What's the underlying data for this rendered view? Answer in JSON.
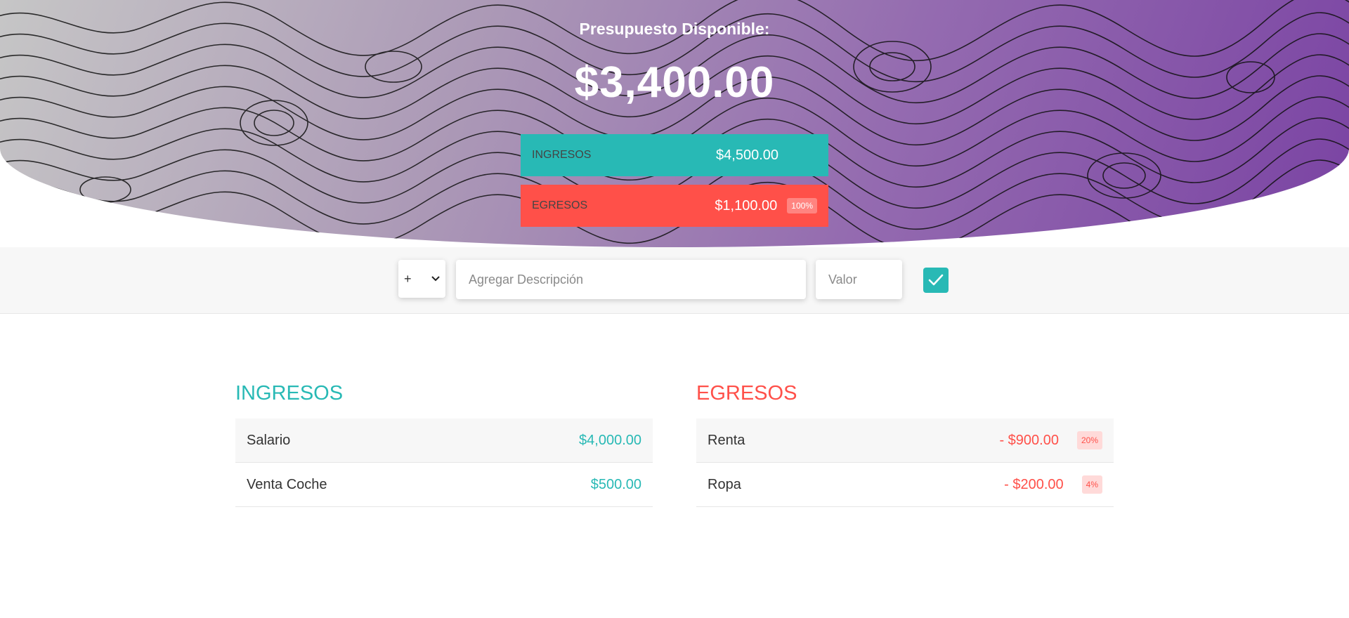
{
  "header": {
    "title": "Presupuesto Disponible:",
    "budget": "$3,400.00"
  },
  "summary": {
    "income": {
      "label": "INGRESOS",
      "amount": "$4,500.00"
    },
    "expense": {
      "label": "EGRESOS",
      "amount": "$1,100.00",
      "percentage": "100%"
    }
  },
  "add_form": {
    "type_selected": "+",
    "description_placeholder": "Agregar Descripción",
    "value_placeholder": "Valor"
  },
  "income_list": {
    "title": "INGRESOS",
    "items": [
      {
        "description": "Salario",
        "value": "$4,000.00"
      },
      {
        "description": "Venta Coche",
        "value": "$500.00"
      }
    ]
  },
  "expense_list": {
    "title": "EGRESOS",
    "items": [
      {
        "description": "Renta",
        "value": "- $900.00",
        "percentage": "20%"
      },
      {
        "description": "Ropa",
        "value": "- $200.00",
        "percentage": "4%"
      }
    ]
  },
  "colors": {
    "income": "#28b9b5",
    "expense": "#ff5049",
    "gradient_start": "#c6c6c6",
    "gradient_end": "#7a43a3"
  },
  "icons": {
    "add_button": "check-icon",
    "type_select": "chevron-down-icon"
  }
}
